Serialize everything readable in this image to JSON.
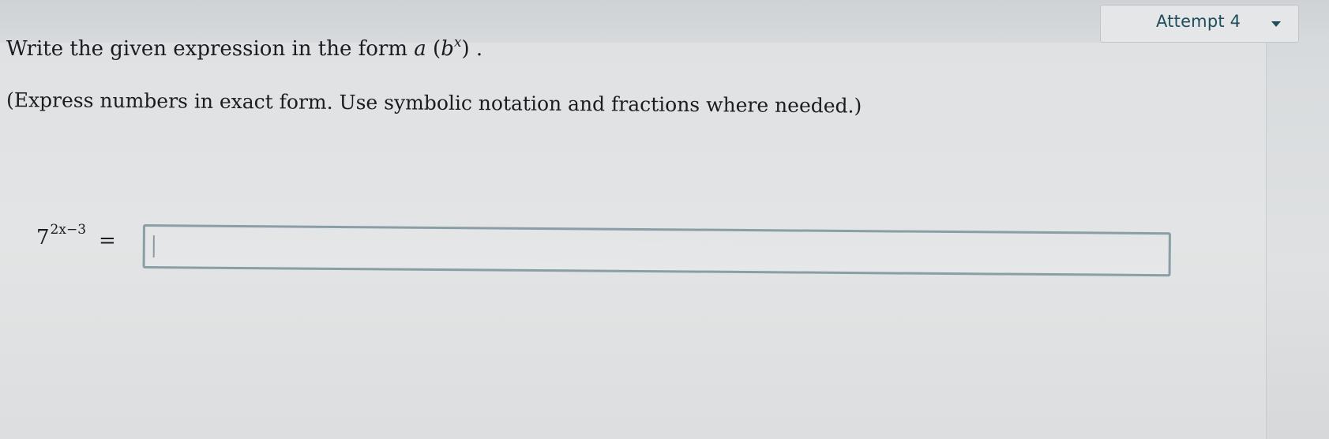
{
  "header": {
    "attempt_label": "Attempt 4"
  },
  "question": {
    "instruction_prefix": "Write the given expression in the form ",
    "form_a": "a",
    "form_open": " (",
    "form_b": "b",
    "form_x": "x",
    "form_close": ") .",
    "note": "(Express numbers in exact form. Use symbolic notation and fractions where needed.)",
    "expression_base": "7",
    "expression_exponent": "2x−3",
    "equals": "="
  },
  "answer": {
    "value": "",
    "placeholder": ""
  },
  "colors": {
    "accent": "#1e4e5c",
    "input_border": "#8a9ea6"
  }
}
